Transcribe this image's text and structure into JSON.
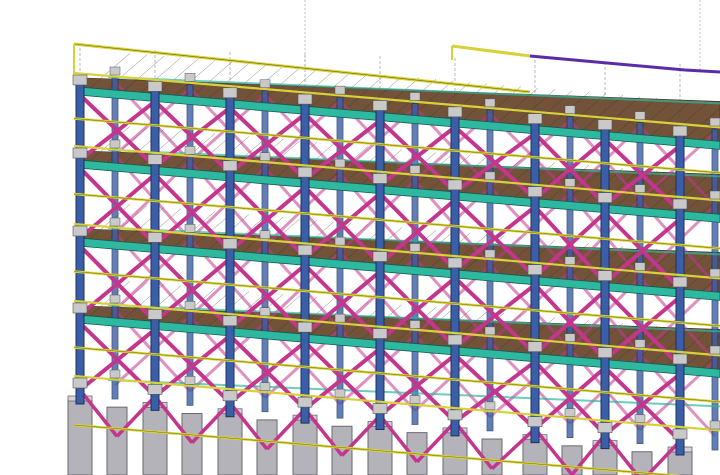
{
  "viewport": {
    "label": "",
    "colors": {
      "background": "#ffffff",
      "column": "#3b5fa6",
      "column_edge": "#1e2f5c",
      "brace": "#c4368e",
      "beam_main": "#2fb8a0",
      "beam_edge": "#0e5f55",
      "rail": "#d8d23a",
      "rail_edge": "#6d6a12",
      "deck": "#6b4a2f",
      "deck_line": "#3b2816",
      "footing": "#b5b3ba",
      "footing_edge": "#6a6870",
      "plate": "#c9c9c9",
      "purple_beam": "#5b2ca8",
      "guide_line": "#9a9a9a"
    }
  }
}
